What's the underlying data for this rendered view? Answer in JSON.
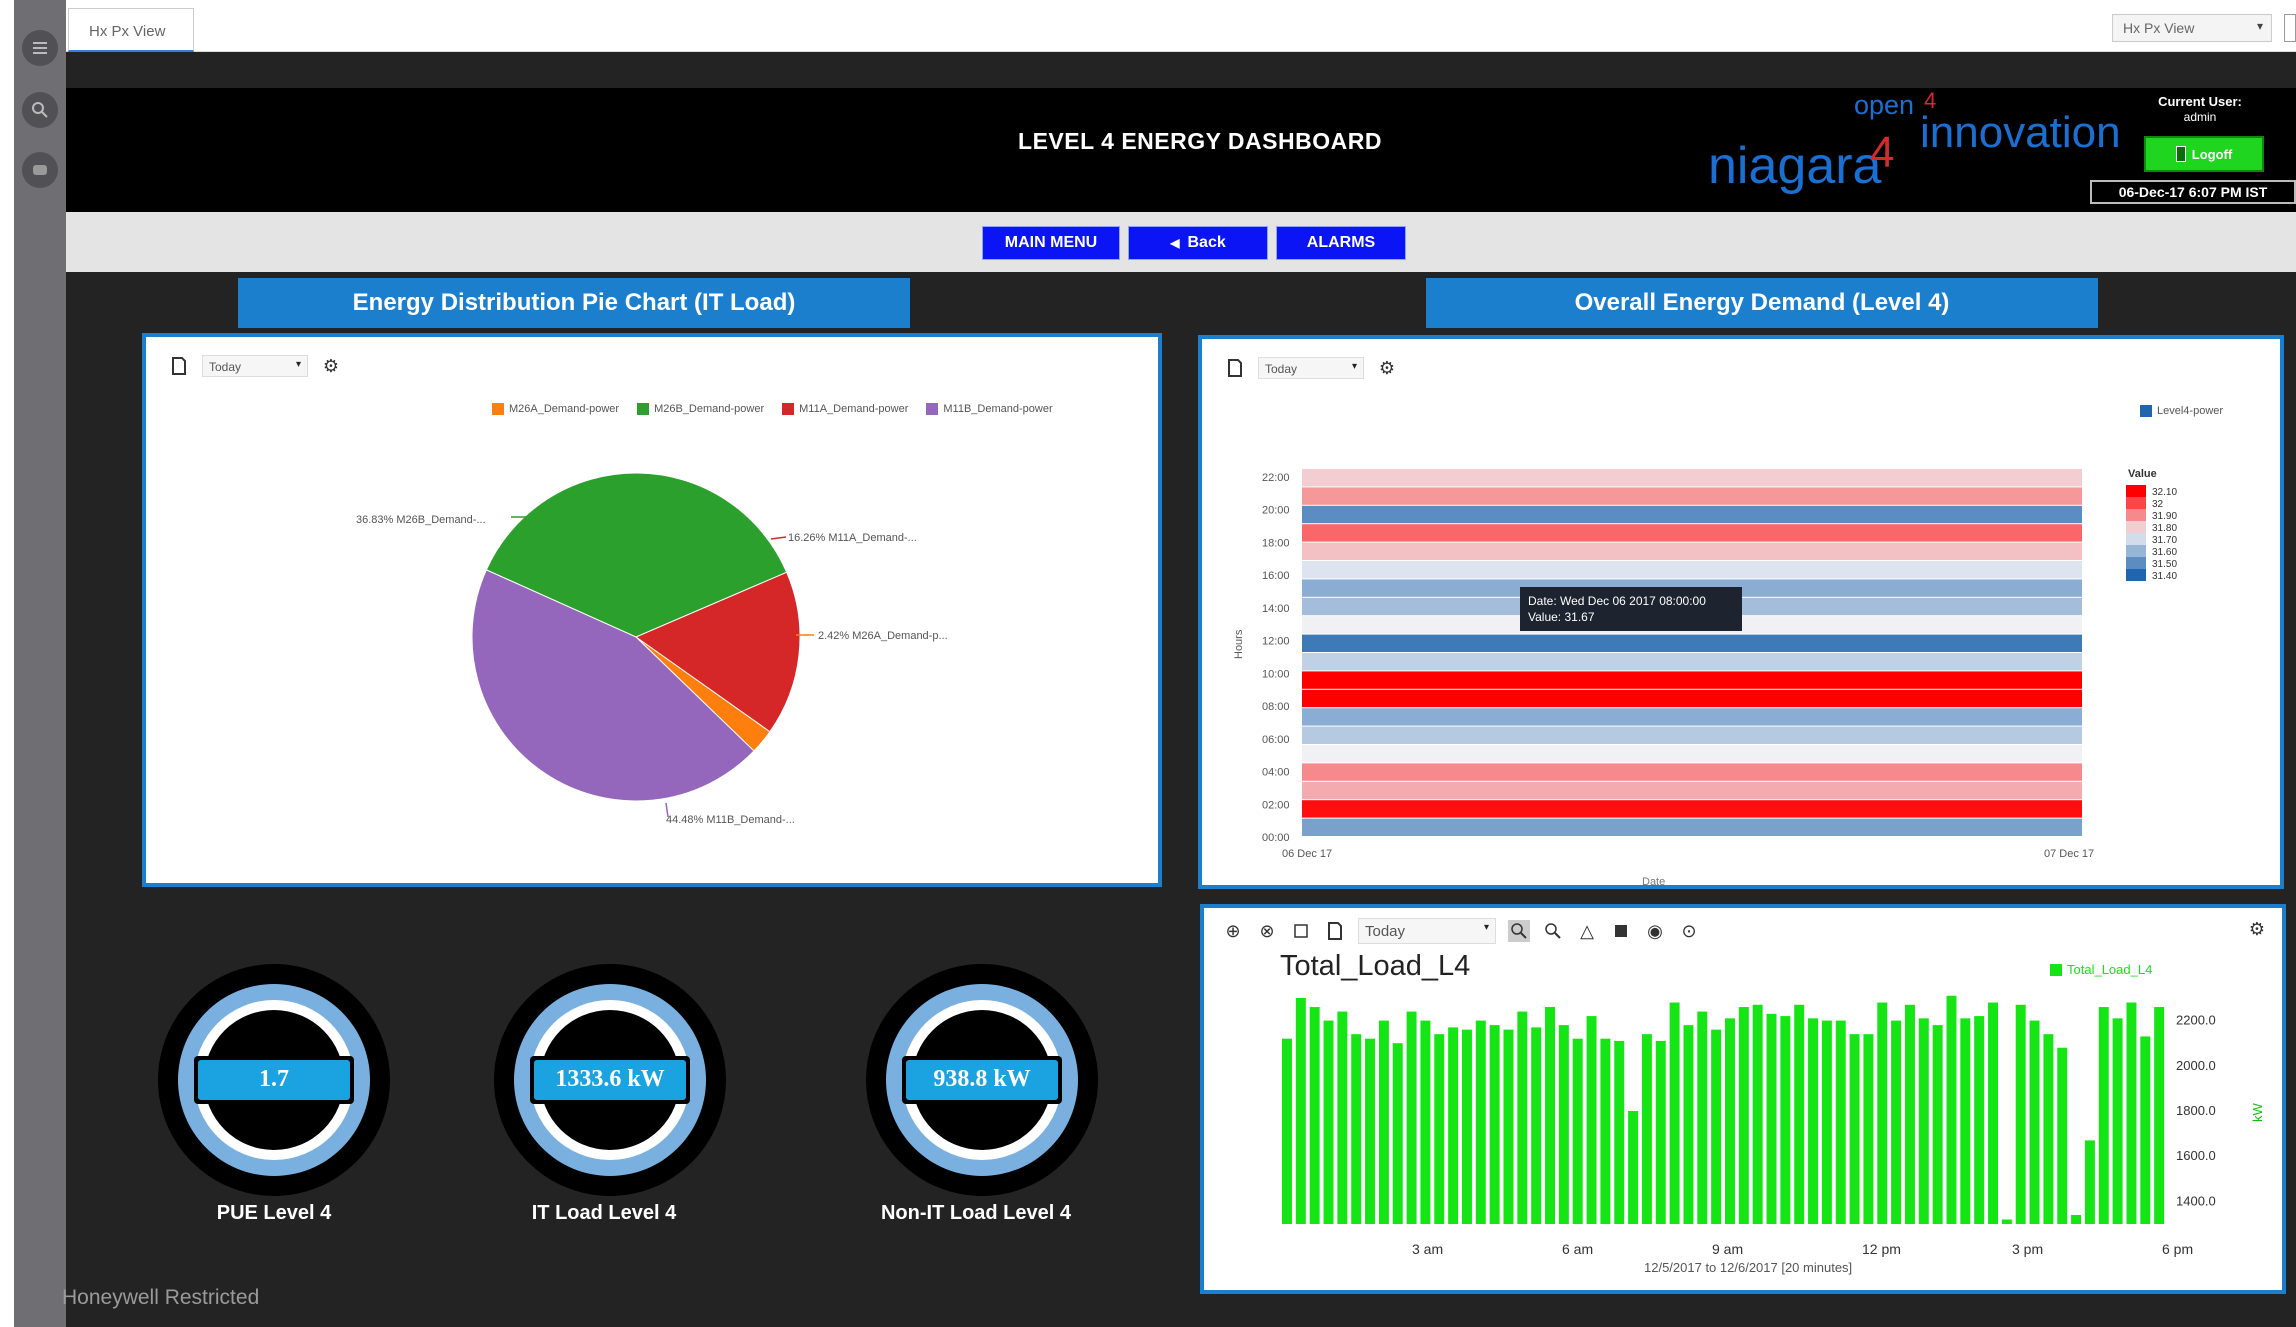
{
  "browser": {
    "tab_label": "Hx Px View",
    "view_select": "Hx Px View"
  },
  "header": {
    "title": "LEVEL 4 ENERGY DASHBOARD",
    "logo": {
      "open": "open",
      "open_sup": "4",
      "innovation": "innovation",
      "niagara": "niagara",
      "niagara_sup": "4"
    },
    "current_user_label": "Current User:",
    "current_user": "admin",
    "logoff_label": "Logoff",
    "datetime": "06-Dec-17 6:07 PM IST"
  },
  "nav": {
    "main_menu": "MAIN MENU",
    "back": "Back",
    "alarms": "ALARMS"
  },
  "pie_section": {
    "header": "Energy Distribution Pie Chart (IT Load)",
    "range_select": "Today",
    "legend": [
      {
        "label": "M26A_Demand-power",
        "color": "#ff7f0e"
      },
      {
        "label": "M26B_Demand-power",
        "color": "#2ca02c"
      },
      {
        "label": "M11A_Demand-power",
        "color": "#d62728"
      },
      {
        "label": "M11B_Demand-power",
        "color": "#9467bd"
      }
    ],
    "slice_labels": {
      "m26b": "36.83% M26B_Demand-...",
      "m11a": "16.26% M11A_Demand-...",
      "m26a": "2.42% M26A_Demand-p...",
      "m11b": "44.48% M11B_Demand-..."
    }
  },
  "heatmap_section": {
    "header": "Overall Energy Demand (Level 4)",
    "range_select": "Today",
    "legend_label": "Level4-power",
    "scale_title": "Value",
    "scale_values": [
      "32.10",
      "32",
      "31.90",
      "31.80",
      "31.70",
      "31.60",
      "31.50",
      "31.40"
    ],
    "y_axis_label": "Hours",
    "x_axis_label": "Date",
    "y_ticks": [
      "22:00",
      "20:00",
      "18:00",
      "16:00",
      "14:00",
      "12:00",
      "10:00",
      "08:00",
      "06:00",
      "04:00",
      "02:00",
      "00:00"
    ],
    "x_ticks": [
      "06 Dec 17",
      "07 Dec 17"
    ],
    "tooltip_date": "Date: Wed Dec 06 2017 08:00:00",
    "tooltip_value": "Value: 31.67"
  },
  "bar_section": {
    "range_select": "Today",
    "title": "Total_Load_L4",
    "legend_label": "Total_Load_L4",
    "y_axis_unit": "kW",
    "y_ticks": [
      "2200.0",
      "2000.0",
      "1800.0",
      "1600.0",
      "1400.0"
    ],
    "x_ticks": [
      "3 am",
      "6 am",
      "9 am",
      "12 pm",
      "3 pm",
      "6 pm"
    ],
    "range_caption": "12/5/2017 to 12/6/2017  [20 minutes]"
  },
  "gauges": [
    {
      "value": "1.7",
      "label": "PUE Level 4"
    },
    {
      "value": "1333.6 kW",
      "label": "IT Load Level 4"
    },
    {
      "value": "938.8 kW",
      "label": "Non-IT Load Level 4"
    }
  ],
  "footer": {
    "text": "Honeywell Restricted"
  },
  "colors": {
    "accent_blue": "#1b7fce",
    "nav_blue": "#0a14f5",
    "bar_green": "#15e515",
    "logoff_green": "#1fd51f"
  },
  "chart_data": [
    {
      "type": "pie",
      "title": "",
      "categories": [
        "M26B_Demand-power",
        "M11A_Demand-power",
        "M26A_Demand-power",
        "M11B_Demand-power"
      ],
      "values": [
        36.83,
        16.26,
        2.42,
        44.48
      ],
      "colors": [
        "#2ca02c",
        "#d62728",
        "#ff7f0e",
        "#9467bd"
      ]
    },
    {
      "type": "heatmap",
      "title": "",
      "xlabel": "Date",
      "ylabel": "Hours",
      "legend": "Level4-power",
      "hours": [
        "00:00",
        "01:00",
        "02:00",
        "03:00",
        "04:00",
        "05:00",
        "06:00",
        "07:00",
        "08:00",
        "09:00",
        "10:00",
        "11:00",
        "12:00",
        "13:00",
        "14:00",
        "15:00",
        "16:00",
        "17:00",
        "18:00",
        "19:00"
      ],
      "values": [
        31.55,
        32.08,
        31.85,
        31.9,
        31.75,
        31.65,
        31.58,
        32.1,
        32.1,
        31.67,
        31.45,
        31.75,
        31.62,
        31.58,
        31.72,
        31.82,
        31.95,
        31.5,
        31.88,
        31.8
      ],
      "value_range": [
        31.4,
        32.1
      ]
    },
    {
      "type": "bar",
      "title": "Total_Load_L4",
      "ylabel": "kW",
      "ylim": [
        1300,
        2300
      ],
      "x_ticks": [
        "3 am",
        "6 am",
        "9 am",
        "12 pm",
        "3 pm",
        "6 pm"
      ],
      "values": [
        2120,
        2300,
        2260,
        2200,
        2240,
        2140,
        2120,
        2200,
        2100,
        2240,
        2200,
        2140,
        2170,
        2160,
        2200,
        2180,
        2160,
        2240,
        2170,
        2260,
        2180,
        2120,
        2220,
        2120,
        2110,
        1800,
        2140,
        2110,
        2280,
        2180,
        2240,
        2160,
        2210,
        2260,
        2270,
        2230,
        2220,
        2270,
        2210,
        2200,
        2200,
        2140,
        2140,
        2280,
        2200,
        2270,
        2210,
        2180,
        2310,
        2210,
        2220,
        2280,
        1320,
        2270,
        2200,
        2140,
        2080,
        1340,
        1670,
        2260,
        2210,
        2280,
        2130,
        2260
      ]
    }
  ]
}
